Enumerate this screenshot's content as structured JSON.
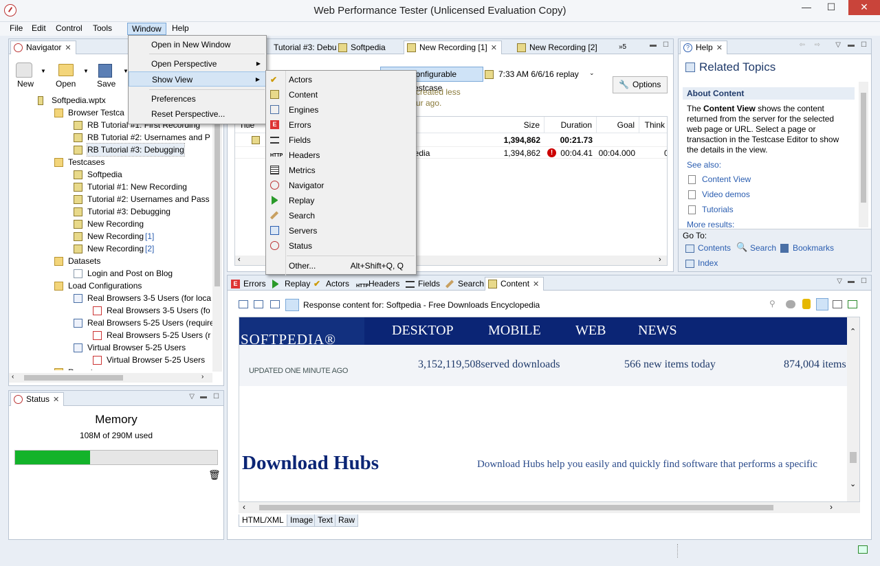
{
  "window": {
    "title": "Web Performance Tester (Unlicensed Evaluation Copy)",
    "min": "—",
    "max": "☐",
    "close": "✕"
  },
  "menubar": [
    "File",
    "Edit",
    "Control",
    "Tools",
    "Window",
    "Help"
  ],
  "window_menu": {
    "items": [
      "Open in New Window",
      "Open Perspective",
      "Show View",
      "Preferences",
      "Reset Perspective..."
    ]
  },
  "show_view_menu": {
    "items": [
      "Actors",
      "Content",
      "Engines",
      "Errors",
      "Fields",
      "Headers",
      "Metrics",
      "Navigator",
      "Replay",
      "Search",
      "Servers",
      "Status"
    ],
    "other": {
      "label": "Other...",
      "shortcut": "Alt+Shift+Q, Q"
    }
  },
  "navigator": {
    "tab": "Navigator",
    "toolbar": [
      "New",
      "Open",
      "Save"
    ],
    "tree": [
      {
        "label": "Softpedia.wptx",
        "indent": 0,
        "icon": "workspace-icon"
      },
      {
        "label": "Browser Testca",
        "indent": 1,
        "icon": "folder-open-icon"
      },
      {
        "label": "RB Tutorial #1: First Recording",
        "indent": 2,
        "icon": "testcase-icon"
      },
      {
        "label": "RB Tutorial #2: Usernames and P",
        "indent": 2,
        "icon": "testcase-icon"
      },
      {
        "label": "RB Tutorial #3: Debugging",
        "indent": 2,
        "icon": "testcase-icon",
        "selected": true
      },
      {
        "label": "Testcases",
        "indent": 1,
        "icon": "folder-open-icon"
      },
      {
        "label": "Softpedia",
        "indent": 2,
        "icon": "testcase-icon"
      },
      {
        "label": "Tutorial #1: New Recording",
        "indent": 2,
        "icon": "testcase-icon"
      },
      {
        "label": "Tutorial #2: Usernames and Pass",
        "indent": 2,
        "icon": "testcase-icon"
      },
      {
        "label": "Tutorial #3: Debugging",
        "indent": 2,
        "icon": "testcase-icon"
      },
      {
        "label": "New Recording",
        "indent": 2,
        "icon": "testcase-icon"
      },
      {
        "label": "New Recording",
        "suffix": "[1]",
        "indent": 2,
        "icon": "testcase-icon"
      },
      {
        "label": "New Recording",
        "suffix": "[2]",
        "indent": 2,
        "icon": "testcase-icon"
      },
      {
        "label": "Datasets",
        "indent": 1,
        "icon": "folder-icon"
      },
      {
        "label": "Login and Post on Blog",
        "indent": 2,
        "icon": "dataset-icon"
      },
      {
        "label": "Load Configurations",
        "indent": 1,
        "icon": "folder-icon"
      },
      {
        "label": "Real Browsers 3-5 Users (for loca",
        "indent": 2,
        "icon": "load-config-icon"
      },
      {
        "label": "Real Browsers 3-5 Users (fo",
        "indent": 3,
        "icon": "chart-icon"
      },
      {
        "label": "Real Browsers 5-25 Users (require",
        "indent": 2,
        "icon": "load-config-icon"
      },
      {
        "label": "Real Browsers 5-25 Users (r",
        "indent": 3,
        "icon": "chart-icon"
      },
      {
        "label": "Virtual Browser 5-25 Users",
        "indent": 2,
        "icon": "load-config-icon"
      },
      {
        "label": "Virtual Browser 5-25 Users",
        "indent": 3,
        "icon": "chart-icon"
      },
      {
        "label": "Reports",
        "indent": 1,
        "icon": "folder-icon"
      }
    ]
  },
  "status": {
    "tab": "Status",
    "heading": "Memory",
    "usage": "108M of 290M used",
    "used_fraction": 0.372
  },
  "editor": {
    "tabs": [
      {
        "label": "Tutorial #3: Debu"
      },
      {
        "label": "Softpedia"
      },
      {
        "label": "New Recording [1]",
        "selected": true
      },
      {
        "label": "New Recording [2]"
      },
      {
        "label": "»5"
      }
    ],
    "testcase_button": "Configurable Testcase",
    "replay_label": "7:33 AM 6/6/16 replay",
    "options_button": "Options",
    "note_line1": "created less",
    "note_line2": "ur ago.",
    "table": {
      "columns": [
        "Title",
        "Size",
        "Duration",
        "Goal",
        "Think"
      ],
      "summary": {
        "size": "1,394,862",
        "duration": "00:21.73"
      },
      "rows": [
        {
          "title": "pedia",
          "size": "1,394,862",
          "duration": "00:04.41",
          "goal": "00:04.000",
          "think": "00:"
        }
      ]
    }
  },
  "help": {
    "tab": "Help",
    "heading": "Related Topics",
    "section_title": "About Content",
    "body_bold": "Content View",
    "body_pre": "The ",
    "body_post": " shows the content returned from the server for the selected web page or URL. Select a page or transaction in the Testcase Editor to show the details in the view.",
    "see_also": "See also:",
    "links": [
      "Content View",
      "Video demos",
      "Tutorials"
    ],
    "more": "More results:",
    "goto": "Go To:",
    "goto_links": [
      "Contents",
      "Search",
      "Bookmarks",
      "Index"
    ]
  },
  "bottom": {
    "tabs": [
      "Errors",
      "Replay",
      "Actors",
      "Headers",
      "Fields",
      "Search",
      "Content"
    ],
    "response_label": "Response content for: Softpedia - Free Downloads Encyclopedia",
    "view_tabs": [
      "HTML/XML",
      "Image",
      "Text",
      "Raw"
    ]
  },
  "webpage": {
    "logo": "SOFTPEDIA®",
    "nav": [
      "DESKTOP",
      "MOBILE",
      "WEB",
      "NEWS"
    ],
    "updated": "UPDATED ONE MINUTE AGO",
    "stat1": "3,152,119,508served downloads",
    "stat2": "566 new items today",
    "stat3": "874,004 items",
    "heading": "Download Hubs",
    "subtext": "Download Hubs help you easily and quickly find software that performs a specific"
  },
  "colors": {
    "accent": "#cfe3f7",
    "softpedia_navy": "#0b2575",
    "memory_bar": "#13b32a",
    "link": "#2a5db0"
  }
}
